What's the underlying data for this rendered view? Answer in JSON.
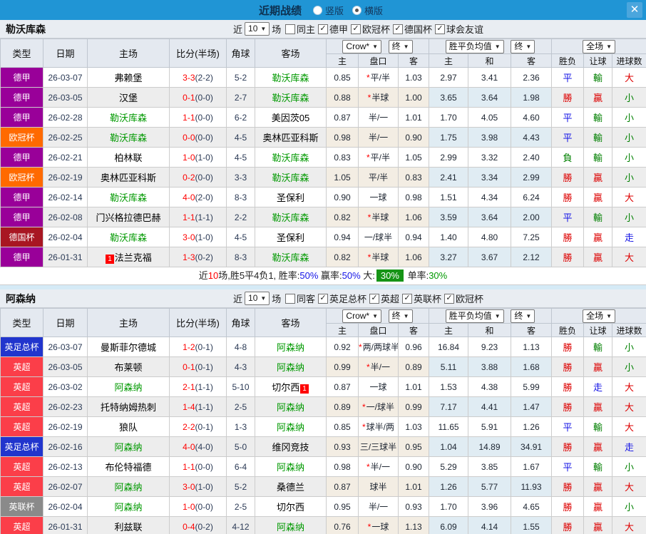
{
  "titlebar": {
    "title": "近期战绩",
    "radio_vertical": "竖版",
    "radio_horizontal": "横版",
    "close": "✕"
  },
  "filters": {
    "near": "近",
    "count": "10",
    "games": "场"
  },
  "columns": {
    "type": "类型",
    "date": "日期",
    "home": "主场",
    "score": "比分(半场)",
    "corner": "角球",
    "away": "客场",
    "bookmaker_select": "Crow*",
    "final_select": "终",
    "avg_select": "胜平负均值",
    "final_select2": "终",
    "scope_select": "全场",
    "sub": [
      "主",
      "盘口",
      "客",
      "主",
      "和",
      "客",
      "胜负",
      "让球",
      "进球数"
    ]
  },
  "league_colors": {
    "德甲": "#990099",
    "欧冠杯": "#ff6a00",
    "德国杯": "#a81622",
    "英足总杯": "#2135cd",
    "英超": "#fb3e49",
    "英联杯": "#8a8a8a"
  },
  "result_colors": {
    "r": "#dd0000",
    "g": "#008000",
    "b": "#1414e6"
  },
  "accent": {
    "titlebar_bg": "#2095d5",
    "team_green": "#009900",
    "score_red": "#ff0000",
    "badge_green": "#169416"
  },
  "sections": [
    {
      "team": "勒沃库森",
      "filter": {
        "same": "同主",
        "leagues": [
          "德甲",
          "欧冠杯",
          "德国杯",
          "球会友谊"
        ]
      },
      "rows": [
        {
          "lg": "德甲",
          "date": "26-03-07",
          "home": "弗赖堡",
          "homeHl": false,
          "homeBadge": "",
          "ft": "3-3",
          "ht": "(2-2)",
          "corner": "5-2",
          "away": "勒沃库森",
          "awayHl": true,
          "awayBadge": "",
          "ch": "0.85",
          "hcStar": true,
          "hc": "平/半",
          "ca": "1.03",
          "ah": "2.97",
          "ad": "3.41",
          "aa": "2.36",
          "wdl": "平",
          "wdlC": "b",
          "hr": "輸",
          "hrC": "g",
          "gl": "大",
          "glC": "r"
        },
        {
          "lg": "德甲",
          "date": "26-03-05",
          "home": "汉堡",
          "homeHl": false,
          "homeBadge": "",
          "ft": "0-1",
          "ht": "(0-0)",
          "corner": "2-7",
          "away": "勒沃库森",
          "awayHl": true,
          "awayBadge": "",
          "ch": "0.88",
          "hcStar": true,
          "hc": "半球",
          "ca": "1.00",
          "ah": "3.65",
          "ad": "3.64",
          "aa": "1.98",
          "wdl": "勝",
          "wdlC": "r",
          "hr": "贏",
          "hrC": "r",
          "gl": "小",
          "glC": "g"
        },
        {
          "lg": "德甲",
          "date": "26-02-28",
          "home": "勒沃库森",
          "homeHl": true,
          "homeBadge": "",
          "ft": "1-1",
          "ht": "(0-0)",
          "corner": "6-2",
          "away": "美因茨05",
          "awayHl": false,
          "awayBadge": "",
          "ch": "0.87",
          "hcStar": false,
          "hc": "半/一",
          "ca": "1.01",
          "ah": "1.70",
          "ad": "4.05",
          "aa": "4.60",
          "wdl": "平",
          "wdlC": "b",
          "hr": "輸",
          "hrC": "g",
          "gl": "小",
          "glC": "g"
        },
        {
          "lg": "欧冠杯",
          "date": "26-02-25",
          "home": "勒沃库森",
          "homeHl": true,
          "homeBadge": "",
          "ft": "0-0",
          "ht": "(0-0)",
          "corner": "4-5",
          "away": "奥林匹亚科斯",
          "awayHl": false,
          "awayBadge": "",
          "ch": "0.98",
          "hcStar": false,
          "hc": "半/一",
          "ca": "0.90",
          "ah": "1.75",
          "ad": "3.98",
          "aa": "4.43",
          "wdl": "平",
          "wdlC": "b",
          "hr": "輸",
          "hrC": "g",
          "gl": "小",
          "glC": "g"
        },
        {
          "lg": "德甲",
          "date": "26-02-21",
          "home": "柏林联",
          "homeHl": false,
          "homeBadge": "",
          "ft": "1-0",
          "ht": "(1-0)",
          "corner": "4-5",
          "away": "勒沃库森",
          "awayHl": true,
          "awayBadge": "",
          "ch": "0.83",
          "hcStar": true,
          "hc": "平/半",
          "ca": "1.05",
          "ah": "2.99",
          "ad": "3.32",
          "aa": "2.40",
          "wdl": "負",
          "wdlC": "g",
          "hr": "輸",
          "hrC": "g",
          "gl": "小",
          "glC": "g"
        },
        {
          "lg": "欧冠杯",
          "date": "26-02-19",
          "home": "奥林匹亚科斯",
          "homeHl": false,
          "homeBadge": "",
          "ft": "0-2",
          "ht": "(0-0)",
          "corner": "3-3",
          "away": "勒沃库森",
          "awayHl": true,
          "awayBadge": "",
          "ch": "1.05",
          "hcStar": false,
          "hc": "平/半",
          "ca": "0.83",
          "ah": "2.41",
          "ad": "3.34",
          "aa": "2.99",
          "wdl": "勝",
          "wdlC": "r",
          "hr": "贏",
          "hrC": "r",
          "gl": "小",
          "glC": "g"
        },
        {
          "lg": "德甲",
          "date": "26-02-14",
          "home": "勒沃库森",
          "homeHl": true,
          "homeBadge": "",
          "ft": "4-0",
          "ht": "(2-0)",
          "corner": "8-3",
          "away": "圣保利",
          "awayHl": false,
          "awayBadge": "",
          "ch": "0.90",
          "hcStar": false,
          "hc": "一球",
          "ca": "0.98",
          "ah": "1.51",
          "ad": "4.34",
          "aa": "6.24",
          "wdl": "勝",
          "wdlC": "r",
          "hr": "贏",
          "hrC": "r",
          "gl": "大",
          "glC": "r"
        },
        {
          "lg": "德甲",
          "date": "26-02-08",
          "home": "门兴格拉德巴赫",
          "homeHl": false,
          "homeBadge": "",
          "ft": "1-1",
          "ht": "(1-1)",
          "corner": "2-2",
          "away": "勒沃库森",
          "awayHl": true,
          "awayBadge": "",
          "ch": "0.82",
          "hcStar": true,
          "hc": "半球",
          "ca": "1.06",
          "ah": "3.59",
          "ad": "3.64",
          "aa": "2.00",
          "wdl": "平",
          "wdlC": "b",
          "hr": "輸",
          "hrC": "g",
          "gl": "小",
          "glC": "g"
        },
        {
          "lg": "德国杯",
          "date": "26-02-04",
          "home": "勒沃库森",
          "homeHl": true,
          "homeBadge": "",
          "ft": "3-0",
          "ht": "(1-0)",
          "corner": "4-5",
          "away": "圣保利",
          "awayHl": false,
          "awayBadge": "",
          "ch": "0.94",
          "hcStar": false,
          "hc": "一/球半",
          "ca": "0.94",
          "ah": "1.40",
          "ad": "4.80",
          "aa": "7.25",
          "wdl": "勝",
          "wdlC": "r",
          "hr": "贏",
          "hrC": "r",
          "gl": "走",
          "glC": "b"
        },
        {
          "lg": "德甲",
          "date": "26-01-31",
          "home": "法兰克福",
          "homeHl": false,
          "homeBadge": "1",
          "ft": "1-3",
          "ht": "(0-2)",
          "corner": "8-3",
          "away": "勒沃库森",
          "awayHl": true,
          "awayBadge": "",
          "ch": "0.82",
          "hcStar": true,
          "hc": "半球",
          "ca": "1.06",
          "ah": "3.27",
          "ad": "3.67",
          "aa": "2.12",
          "wdl": "勝",
          "wdlC": "r",
          "hr": "贏",
          "hrC": "r",
          "gl": "大",
          "glC": "r"
        }
      ],
      "summary": [
        {
          "t": "近",
          "c": "k"
        },
        {
          "t": "10",
          "c": "r"
        },
        {
          "t": "场,胜5平4负1, 胜率:",
          "c": "k"
        },
        {
          "t": "50%",
          "c": "b"
        },
        {
          "t": " 赢率:",
          "c": "k"
        },
        {
          "t": "50%",
          "c": "b"
        },
        {
          "t": " 大:",
          "c": "k"
        },
        {
          "t": "30%",
          "c": "badge"
        },
        {
          "t": " 单率:",
          "c": "k"
        },
        {
          "t": "30%",
          "c": "g"
        }
      ]
    },
    {
      "team": "阿森纳",
      "filter": {
        "same": "同客",
        "leagues": [
          "英足总杯",
          "英超",
          "英联杯",
          "欧冠杯"
        ]
      },
      "rows": [
        {
          "lg": "英足总杯",
          "date": "26-03-07",
          "home": "曼斯菲尔德城",
          "homeHl": false,
          "homeBadge": "",
          "ft": "1-2",
          "ht": "(0-1)",
          "corner": "4-8",
          "away": "阿森纳",
          "awayHl": true,
          "awayBadge": "",
          "ch": "0.92",
          "hcStar": true,
          "hc": "两/两球半",
          "ca": "0.96",
          "ah": "16.84",
          "ad": "9.23",
          "aa": "1.13",
          "wdl": "勝",
          "wdlC": "r",
          "hr": "輸",
          "hrC": "g",
          "gl": "小",
          "glC": "g"
        },
        {
          "lg": "英超",
          "date": "26-03-05",
          "home": "布莱顿",
          "homeHl": false,
          "homeBadge": "",
          "ft": "0-1",
          "ht": "(0-1)",
          "corner": "4-3",
          "away": "阿森纳",
          "awayHl": true,
          "awayBadge": "",
          "ch": "0.99",
          "hcStar": true,
          "hc": "半/一",
          "ca": "0.89",
          "ah": "5.11",
          "ad": "3.88",
          "aa": "1.68",
          "wdl": "勝",
          "wdlC": "r",
          "hr": "贏",
          "hrC": "r",
          "gl": "小",
          "glC": "g"
        },
        {
          "lg": "英超",
          "date": "26-03-02",
          "home": "阿森纳",
          "homeHl": true,
          "homeBadge": "",
          "ft": "2-1",
          "ht": "(1-1)",
          "corner": "5-10",
          "away": "切尔西",
          "awayHl": false,
          "awayBadge": "1",
          "ch": "0.87",
          "hcStar": false,
          "hc": "一球",
          "ca": "1.01",
          "ah": "1.53",
          "ad": "4.38",
          "aa": "5.99",
          "wdl": "勝",
          "wdlC": "r",
          "hr": "走",
          "hrC": "b",
          "gl": "大",
          "glC": "r"
        },
        {
          "lg": "英超",
          "date": "26-02-23",
          "home": "托特纳姆热刺",
          "homeHl": false,
          "homeBadge": "",
          "ft": "1-4",
          "ht": "(1-1)",
          "corner": "2-5",
          "away": "阿森纳",
          "awayHl": true,
          "awayBadge": "",
          "ch": "0.89",
          "hcStar": true,
          "hc": "一/球半",
          "ca": "0.99",
          "ah": "7.17",
          "ad": "4.41",
          "aa": "1.47",
          "wdl": "勝",
          "wdlC": "r",
          "hr": "贏",
          "hrC": "r",
          "gl": "大",
          "glC": "r"
        },
        {
          "lg": "英超",
          "date": "26-02-19",
          "home": "狼队",
          "homeHl": false,
          "homeBadge": "",
          "ft": "2-2",
          "ht": "(0-1)",
          "corner": "1-3",
          "away": "阿森纳",
          "awayHl": true,
          "awayBadge": "",
          "ch": "0.85",
          "hcStar": true,
          "hc": "球半/两",
          "ca": "1.03",
          "ah": "11.65",
          "ad": "5.91",
          "aa": "1.26",
          "wdl": "平",
          "wdlC": "b",
          "hr": "輸",
          "hrC": "g",
          "gl": "大",
          "glC": "r"
        },
        {
          "lg": "英足总杯",
          "date": "26-02-16",
          "home": "阿森纳",
          "homeHl": true,
          "homeBadge": "",
          "ft": "4-0",
          "ht": "(4-0)",
          "corner": "5-0",
          "away": "维冈竞技",
          "awayHl": false,
          "awayBadge": "",
          "ch": "0.93",
          "hcStar": false,
          "hc": "三/三球半",
          "ca": "0.95",
          "ah": "1.04",
          "ad": "14.89",
          "aa": "34.91",
          "wdl": "勝",
          "wdlC": "r",
          "hr": "贏",
          "hrC": "r",
          "gl": "走",
          "glC": "b"
        },
        {
          "lg": "英超",
          "date": "26-02-13",
          "home": "布伦特福德",
          "homeHl": false,
          "homeBadge": "",
          "ft": "1-1",
          "ht": "(0-0)",
          "corner": "6-4",
          "away": "阿森纳",
          "awayHl": true,
          "awayBadge": "",
          "ch": "0.98",
          "hcStar": true,
          "hc": "半/一",
          "ca": "0.90",
          "ah": "5.29",
          "ad": "3.85",
          "aa": "1.67",
          "wdl": "平",
          "wdlC": "b",
          "hr": "輸",
          "hrC": "g",
          "gl": "小",
          "glC": "g"
        },
        {
          "lg": "英超",
          "date": "26-02-07",
          "home": "阿森纳",
          "homeHl": true,
          "homeBadge": "",
          "ft": "3-0",
          "ht": "(1-0)",
          "corner": "5-2",
          "away": "桑德兰",
          "awayHl": false,
          "awayBadge": "",
          "ch": "0.87",
          "hcStar": false,
          "hc": "球半",
          "ca": "1.01",
          "ah": "1.26",
          "ad": "5.77",
          "aa": "11.93",
          "wdl": "勝",
          "wdlC": "r",
          "hr": "贏",
          "hrC": "r",
          "gl": "大",
          "glC": "r"
        },
        {
          "lg": "英联杯",
          "date": "26-02-04",
          "home": "阿森纳",
          "homeHl": true,
          "homeBadge": "",
          "ft": "1-0",
          "ht": "(0-0)",
          "corner": "2-5",
          "away": "切尔西",
          "awayHl": false,
          "awayBadge": "",
          "ch": "0.95",
          "hcStar": false,
          "hc": "半/一",
          "ca": "0.93",
          "ah": "1.70",
          "ad": "3.96",
          "aa": "4.65",
          "wdl": "勝",
          "wdlC": "r",
          "hr": "贏",
          "hrC": "r",
          "gl": "小",
          "glC": "g"
        },
        {
          "lg": "英超",
          "date": "26-01-31",
          "home": "利兹联",
          "homeHl": false,
          "homeBadge": "",
          "ft": "0-4",
          "ht": "(0-2)",
          "corner": "4-12",
          "away": "阿森纳",
          "awayHl": true,
          "awayBadge": "",
          "ch": "0.76",
          "hcStar": true,
          "hc": "一球",
          "ca": "1.13",
          "ah": "6.09",
          "ad": "4.14",
          "aa": "1.55",
          "wdl": "勝",
          "wdlC": "r",
          "hr": "贏",
          "hrC": "r",
          "gl": "大",
          "glC": "r"
        }
      ]
    }
  ]
}
